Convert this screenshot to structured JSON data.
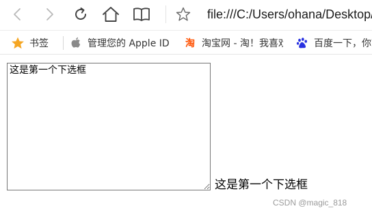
{
  "browser": {
    "address": "file:///C:/Users/ohana/Desktop/",
    "icons": {
      "back": "chevron-left-icon",
      "forward": "chevron-right-icon",
      "reload": "reload-icon",
      "home": "home-icon",
      "reader": "book-icon",
      "favorite": "star-outline-icon"
    }
  },
  "bookmarks": [
    {
      "icon": "star-filled-icon",
      "label": "书签"
    },
    {
      "icon": "apple-icon",
      "label": "管理您的 Apple ID"
    },
    {
      "icon": "taobao-icon",
      "glyph": "淘",
      "label": "淘宝网 - 淘！我喜欢"
    },
    {
      "icon": "baidu-paw-icon",
      "label": "百度一下，你就知道"
    }
  ],
  "page": {
    "textarea_value": "这是第一个下选框",
    "label_text": "这是第一个下选框"
  },
  "watermark": "CSDN @magic_818",
  "colors": {
    "star": "#f5a623",
    "taobao": "#ff5000",
    "baidu": "#2932e1",
    "icon_gray": "#444444"
  }
}
